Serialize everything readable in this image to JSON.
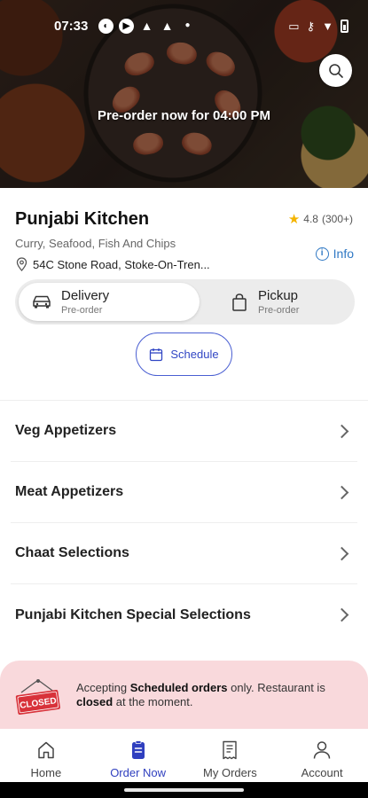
{
  "status_bar": {
    "time": "07:33",
    "left_icons": [
      "circle-half-icon",
      "play-icon",
      "android-icon",
      "android-icon",
      "dot-icon"
    ],
    "right_icons": [
      "cast-icon",
      "key-icon",
      "wifi-icon",
      "battery-icon"
    ]
  },
  "hero": {
    "banner": "Pre-order now for 04:00 PM",
    "search_icon": "search-icon"
  },
  "restaurant": {
    "name": "Punjabi Kitchen",
    "rating": "4.8",
    "rating_count": "(300+)",
    "cuisines": "Curry, Seafood, Fish And Chips",
    "address": "54C Stone Road, Stoke-On-Tren...",
    "info_label": "Info"
  },
  "mode_toggle": {
    "delivery": {
      "title": "Delivery",
      "subtitle": "Pre-order",
      "icon": "car-icon"
    },
    "pickup": {
      "title": "Pickup",
      "subtitle": "Pre-order",
      "icon": "bag-icon"
    }
  },
  "schedule": {
    "label": "Schedule",
    "icon": "calendar-icon"
  },
  "menu": {
    "items": [
      {
        "label": "Veg Appetizers"
      },
      {
        "label": "Meat Appetizers"
      },
      {
        "label": "Chaat Selections"
      },
      {
        "label": "Punjabi Kitchen Special Selections"
      }
    ]
  },
  "closed_notice": {
    "sign_text": "CLOSED",
    "part1": "Accepting ",
    "bold1": "Scheduled orders",
    "part2": " only. Restaurant is ",
    "bold2": "closed",
    "part3": " at the moment."
  },
  "bottom_nav": {
    "items": [
      {
        "label": "Home",
        "icon": "home-icon"
      },
      {
        "label": "Order Now",
        "icon": "order-clipboard-icon"
      },
      {
        "label": "My Orders",
        "icon": "receipt-icon"
      },
      {
        "label": "Account",
        "icon": "person-icon"
      }
    ]
  },
  "colors": {
    "accent": "#2f3fbf",
    "info": "#2f78c4",
    "star": "#f4b400",
    "closed_bg": "#f9d9dc",
    "closed_sign": "#d8323a"
  }
}
